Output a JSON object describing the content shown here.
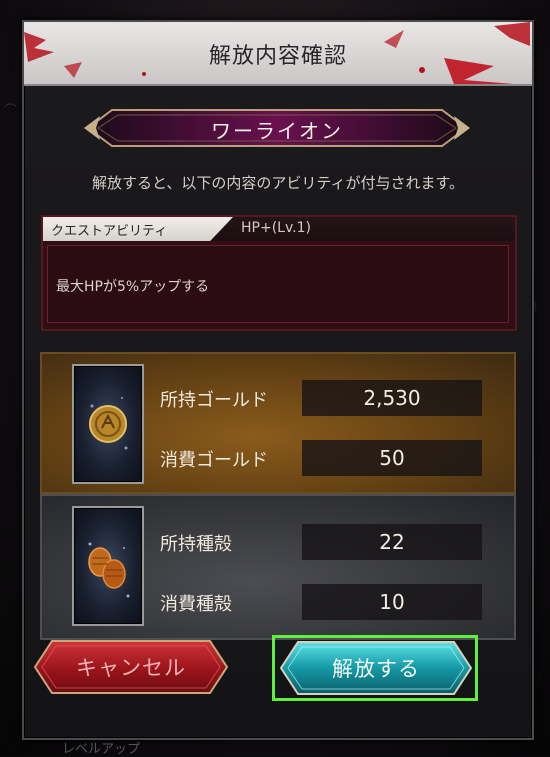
{
  "dialog": {
    "title": "解放内容確認",
    "character_name": "ワーライオン",
    "info": "解放すると、以下の内容のアビリティが付与されます。"
  },
  "ability": {
    "tab_label": "クエストアビリティ",
    "level": "HP+(Lv.1)",
    "description": "最大HPが5%アップする"
  },
  "gold": {
    "owned_label": "所持ゴールド",
    "owned_value": "2,530",
    "cost_label": "消費ゴールド",
    "cost_value": "50",
    "icon": "gold-coin-icon"
  },
  "seed": {
    "owned_label": "所持種殻",
    "owned_value": "22",
    "cost_label": "消費種殻",
    "cost_value": "10",
    "icon": "seed-husk-icon"
  },
  "buttons": {
    "cancel": "キャンセル",
    "confirm": "解放する"
  },
  "footer": {
    "peek_text": "レベルアップ"
  },
  "colors": {
    "header_bg": "#e0dddc",
    "ability_red": "#5a1620",
    "gold_panel": "#7a5018",
    "seed_panel": "#3d3e43",
    "cancel_red": "#b01c22",
    "confirm_teal": "#1aa9b4",
    "highlight_green": "#5ef03a"
  }
}
